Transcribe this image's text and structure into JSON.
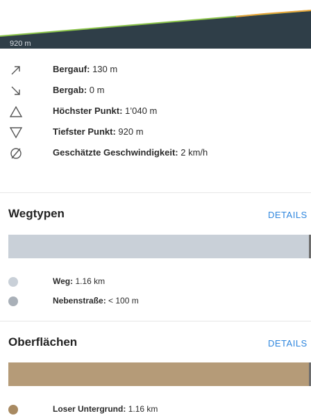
{
  "profile": {
    "min_elevation_label": "920 m"
  },
  "stats": [
    {
      "icon": "arrow-up-right-icon",
      "label": "Bergauf:",
      "value": "130 m"
    },
    {
      "icon": "arrow-down-right-icon",
      "label": "Bergab:",
      "value": "0 m"
    },
    {
      "icon": "triangle-up-icon",
      "label": "Höchster Punkt:",
      "value": "1’040 m"
    },
    {
      "icon": "triangle-down-icon",
      "label": "Tiefster Punkt:",
      "value": "920 m"
    },
    {
      "icon": "average-speed-icon",
      "label": "Geschätzte Geschwindigkeit:",
      "value": "2 km/h"
    }
  ],
  "wegtypen": {
    "title": "Wegtypen",
    "details_label": "DETAILS",
    "bar_color": "#c9d0d8",
    "items": [
      {
        "label": "Weg:",
        "value": "1.16 km",
        "color": "#c9d0d8"
      },
      {
        "label": "Nebenstraße:",
        "value": "< 100 m",
        "color": "#a9b0b8"
      }
    ]
  },
  "oberflaechen": {
    "title": "Oberflächen",
    "details_label": "DETAILS",
    "bar_color": "#b59b78",
    "items": [
      {
        "label": "Loser Untergrund:",
        "value": "1.16 km",
        "color": "#a88a62"
      }
    ]
  }
}
